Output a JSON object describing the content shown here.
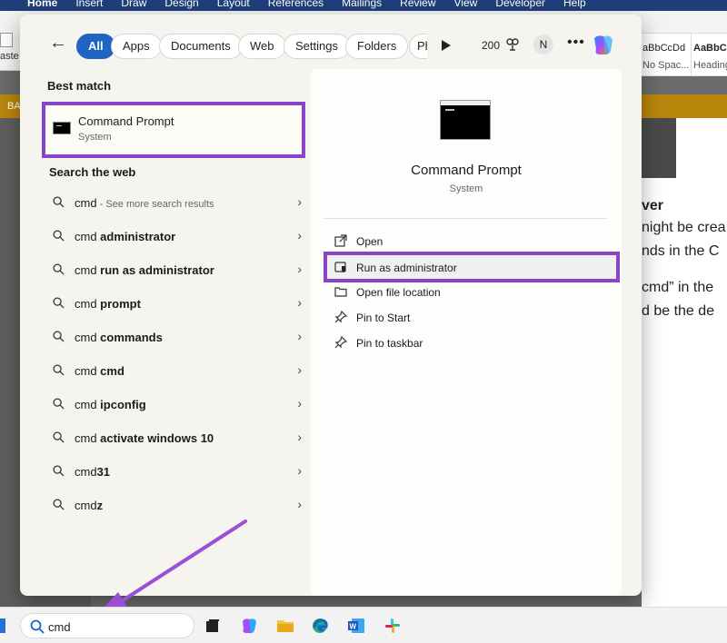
{
  "word": {
    "tabs": [
      "Home",
      "Insert",
      "Draw",
      "Design",
      "Layout",
      "References",
      "Mailings",
      "Review",
      "View",
      "Developer",
      "Help"
    ],
    "paste_label": "aste",
    "styles": [
      {
        "preview": "aBbCcDd",
        "name": "No Spac..."
      },
      {
        "preview": "AaBbCc",
        "name": "Heading"
      }
    ],
    "gold_bar_text": "BA",
    "doc_lines": [
      "ver",
      "night be crea",
      "nds in the C",
      "cmd” in the",
      "d be the de"
    ]
  },
  "search_panel": {
    "filters": [
      {
        "label": "All",
        "active": true
      },
      {
        "label": "Apps"
      },
      {
        "label": "Documents"
      },
      {
        "label": "Web"
      },
      {
        "label": "Settings"
      },
      {
        "label": "Folders"
      },
      {
        "label": "Ph"
      }
    ],
    "points": "200",
    "avatar_initial": "N",
    "best_match_label": "Best match",
    "best_match": {
      "title": "Command Prompt",
      "subtitle": "System"
    },
    "search_web_label": "Search the web",
    "web_results": [
      {
        "query": "cmd",
        "suffix": "",
        "hint": " - See more search results"
      },
      {
        "query": "cmd",
        "suffix": " administrator",
        "hint": ""
      },
      {
        "query": "cmd",
        "suffix": " run as administrator",
        "hint": ""
      },
      {
        "query": "cmd",
        "suffix": " prompt",
        "hint": ""
      },
      {
        "query": "cmd",
        "suffix": " commands",
        "hint": ""
      },
      {
        "query": "cmd",
        "suffix": " cmd",
        "hint": ""
      },
      {
        "query": "cmd",
        "suffix": " ipconfig",
        "hint": ""
      },
      {
        "query": "cmd",
        "suffix": " activate windows 10",
        "hint": ""
      },
      {
        "query": "cmd",
        "suffix": "31",
        "hint": ""
      },
      {
        "query": "cmd",
        "suffix": "z",
        "hint": ""
      }
    ],
    "preview": {
      "title": "Command Prompt",
      "subtitle": "System",
      "actions": [
        {
          "label": "Open",
          "icon": "open-icon"
        },
        {
          "label": "Run as administrator",
          "icon": "shield-icon",
          "highlight": true
        },
        {
          "label": "Open file location",
          "icon": "folder-icon"
        },
        {
          "label": "Pin to Start",
          "icon": "pin-icon"
        },
        {
          "label": "Pin to taskbar",
          "icon": "pin-icon"
        }
      ]
    }
  },
  "taskbar": {
    "search_value": "cmd"
  },
  "colors": {
    "highlight": "#8a44cc",
    "accent": "#1f63c4",
    "word_blue": "#1f3f7a"
  }
}
